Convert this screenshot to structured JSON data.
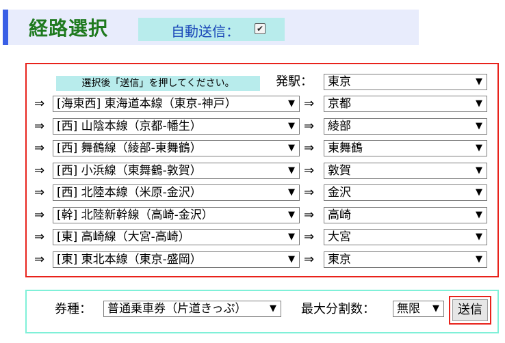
{
  "header": {
    "title": "経路選択",
    "auto_submit_label": "自動送信：",
    "auto_submit_checked": true
  },
  "route": {
    "hint": "選択後「送信」を押してください。",
    "departure_label": "発駅：",
    "departure_station": "東京",
    "arrow": "⇒",
    "rows": [
      {
        "line": "[海東西]  東海道本線（東京-神戸）",
        "station": "京都"
      },
      {
        "line": "[西]  山陰本線（京都-幡生）",
        "station": "綾部"
      },
      {
        "line": "[西]  舞鶴線（綾部-東舞鶴）",
        "station": "東舞鶴"
      },
      {
        "line": "[西]  小浜線（東舞鶴-敦賀）",
        "station": "敦賀"
      },
      {
        "line": "[西]  北陸本線（米原-金沢）",
        "station": "金沢"
      },
      {
        "line": "[幹]  北陸新幹線（高崎-金沢）",
        "station": "高崎"
      },
      {
        "line": "[東]  高崎線（大宮-高崎）",
        "station": "大宮"
      },
      {
        "line": "[東]  東北本線（東京-盛岡）",
        "station": "東京"
      }
    ]
  },
  "ticket": {
    "type_label": "券種：",
    "type_value": "普通乗車券（片道きっぷ）",
    "max_split_label": "最大分割数：",
    "max_split_value": "無限",
    "submit_label": "送信"
  },
  "icons": {
    "dropdown": "▼",
    "checkbox": "✔"
  }
}
